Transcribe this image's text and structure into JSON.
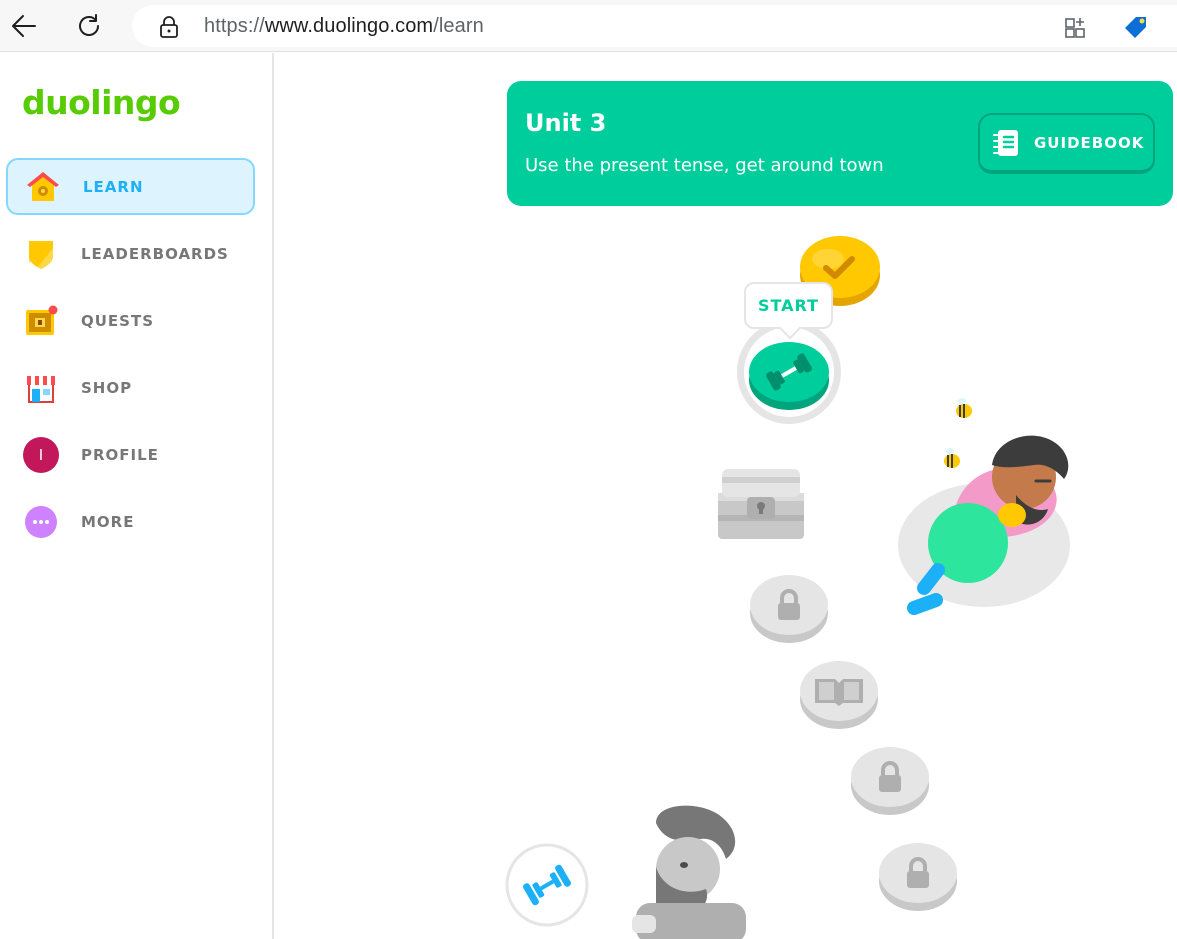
{
  "browser": {
    "url_scheme": "https://",
    "url_host": "www.duolingo.com",
    "url_path": "/learn",
    "icons": [
      "back-arrow-icon",
      "reload-icon",
      "lock-icon",
      "add-tab-icon",
      "tag-icon"
    ]
  },
  "sidebar": {
    "logo": "duolingo",
    "items": [
      {
        "label": "LEARN",
        "icon": "home-icon",
        "active": true
      },
      {
        "label": "LEADERBOARDS",
        "icon": "shield-icon",
        "active": false
      },
      {
        "label": "QUESTS",
        "icon": "treasure-chest-icon",
        "active": false
      },
      {
        "label": "SHOP",
        "icon": "shop-icon",
        "active": false
      },
      {
        "label": "PROFILE",
        "icon": "avatar-icon",
        "active": false,
        "avatar_letter": "I"
      },
      {
        "label": "MORE",
        "icon": "more-icon",
        "active": false
      }
    ]
  },
  "unit": {
    "title": "Unit 3",
    "description": "Use the present tense, get around town",
    "guidebook_label": "GUIDEBOOK"
  },
  "path": {
    "start_label": "START",
    "nodes": [
      {
        "type": "completed",
        "icon": "check-icon"
      },
      {
        "type": "current",
        "icon": "dumbbell-icon"
      },
      {
        "type": "locked-chest",
        "icon": "chest-icon"
      },
      {
        "type": "locked",
        "icon": "lock-icon"
      },
      {
        "type": "locked-story",
        "icon": "book-icon"
      },
      {
        "type": "locked",
        "icon": "lock-icon"
      },
      {
        "type": "locked",
        "icon": "lock-icon"
      },
      {
        "type": "practice",
        "icon": "dumbbell-icon"
      }
    ]
  },
  "colors": {
    "brand_green": "#58cc02",
    "unit_teal": "#00cd9c",
    "active_blue": "#1cb0f6",
    "locked_gray": "#e5e5e5"
  }
}
